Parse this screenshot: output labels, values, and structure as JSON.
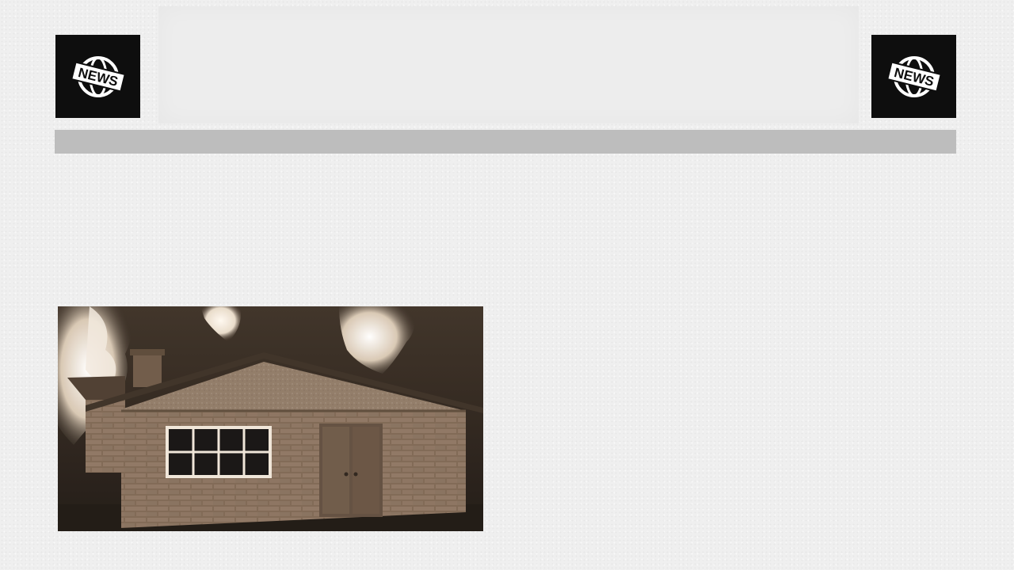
{
  "masthead": {
    "logo_left": {
      "icon": "news-globe-icon",
      "text": "NEWS"
    },
    "logo_right": {
      "icon": "news-globe-icon",
      "text": "NEWS"
    }
  },
  "article": {
    "image": {
      "subject": "house-on-fire-illustration"
    }
  },
  "colors": {
    "page_background": "#efefef",
    "logo_background": "#0e0e0e",
    "nav_bar": "#bdbdbd",
    "sepia_dark": "#2a2119",
    "sepia_light": "#f3e7d8"
  }
}
